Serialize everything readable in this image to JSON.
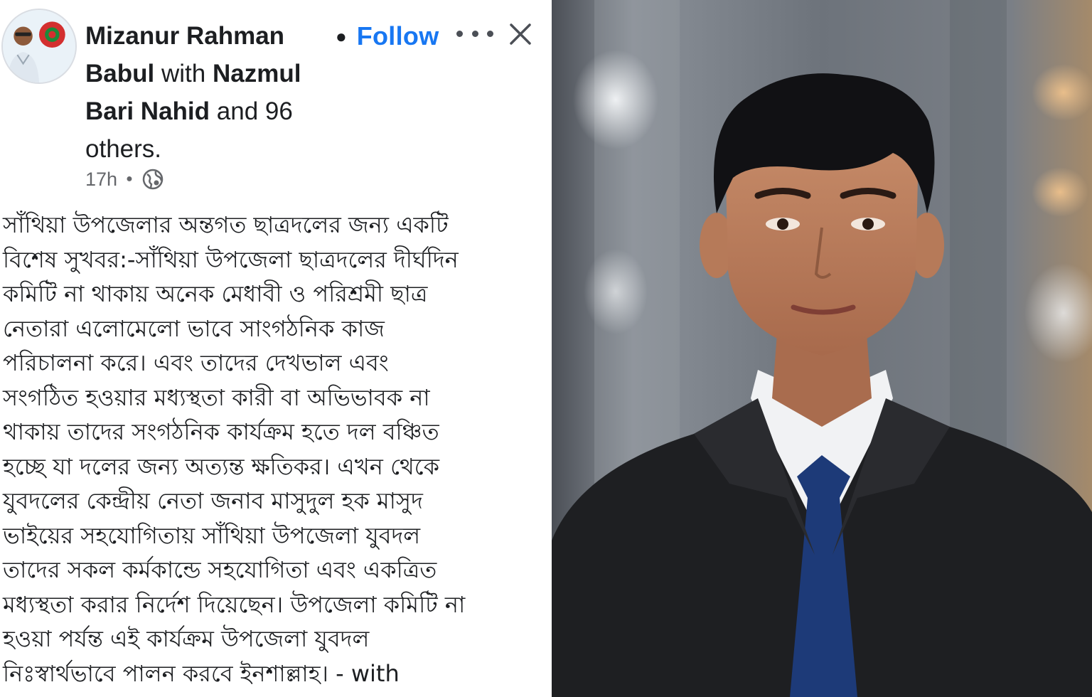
{
  "post": {
    "author_first": "Mizanur Rahman",
    "author_second": "Babul",
    "with_word": "with",
    "tagged_first": "Nazmul",
    "tagged_second": "Bari Nahid",
    "and_others": "and 96",
    "others": "others.",
    "follow_label": "Follow",
    "time": "17h",
    "privacy_icon": "globe-icon",
    "body_lines": [
      "সাঁথিয়া উপজেলার অন্তগত ছাত্রদলের জন্য একটি",
      "বিশেষ সুখবর:-সাঁথিয়া উপজেলা ছাত্রদলের দীর্ঘদিন",
      "কমিটি না থাকায় অনেক মেধাবী ও পরিশ্রমী ছাত্র",
      "নেতারা এলোমেলো ভাবে সাংগঠনিক কাজ",
      "পরিচালনা করে। এবং তাদের দেখভাল এবং",
      "সংগঠিত হওয়ার মধ্যস্থতা কারী বা অভিভাবক না",
      "থাকায় তাদের সংগঠনিক কার্যক্রম হতে দল বঞ্চিত",
      "হচ্ছে যা দলের জন্য অত্যন্ত ক্ষতিকর। এখন থেকে",
      "যুবদলের কেন্দ্রীয় নেতা জনাব মাসুদুল হক মাসুদ",
      "ভাইয়ের সহযোগিতায় সাঁথিয়া উপজেলা যুবদল",
      "তাদের সকল কর্মকান্ডে সহযোগিতা এবং একত্রিত",
      "মধ্যস্থতা করার নির্দেশ দিয়েছেন। উপজেলা কমিটি না",
      "হওয়া পর্যন্ত এই কার্যক্রম উপজেলা যুবদল",
      "নিঃস্বার্থভাবে পালন করবে ইনশাল্লাহ। - with"
    ]
  },
  "colors": {
    "follow_blue": "#1877f2",
    "text": "#1c1e21",
    "meta_gray": "#65676b"
  },
  "icons": {
    "more": "more-options-icon",
    "close": "close-icon"
  }
}
